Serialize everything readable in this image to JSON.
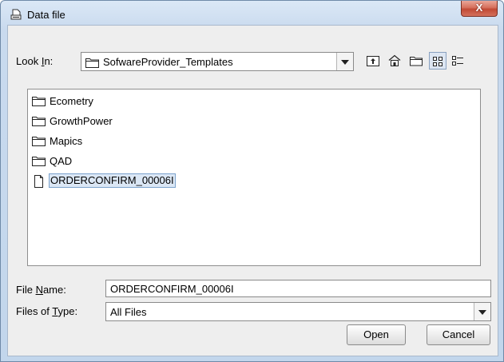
{
  "window": {
    "title": "Data file",
    "close_label": "X"
  },
  "look_in": {
    "label_pre": "Look ",
    "label_mnemonic": "I",
    "label_post": "n:",
    "value": "SofwareProvider_Templates"
  },
  "toolbar": {
    "icons": [
      "up-one-level-icon",
      "home-icon",
      "new-folder-icon",
      "list-view-icon",
      "details-view-icon"
    ]
  },
  "files": [
    {
      "name": "Ecometry",
      "type": "folder"
    },
    {
      "name": "GrowthPower",
      "type": "folder"
    },
    {
      "name": "Mapics",
      "type": "folder"
    },
    {
      "name": "QAD",
      "type": "folder"
    },
    {
      "name": "ORDERCONFIRM_00006I",
      "type": "file",
      "selected": true
    }
  ],
  "file_name": {
    "label_pre": "File ",
    "label_mnemonic": "N",
    "label_post": "ame:",
    "value": "ORDERCONFIRM_00006I"
  },
  "files_of_type": {
    "label_pre": "Files of ",
    "label_mnemonic": "T",
    "label_post": "ype:",
    "value": "All Files"
  },
  "buttons": {
    "open": "Open",
    "cancel": "Cancel"
  }
}
